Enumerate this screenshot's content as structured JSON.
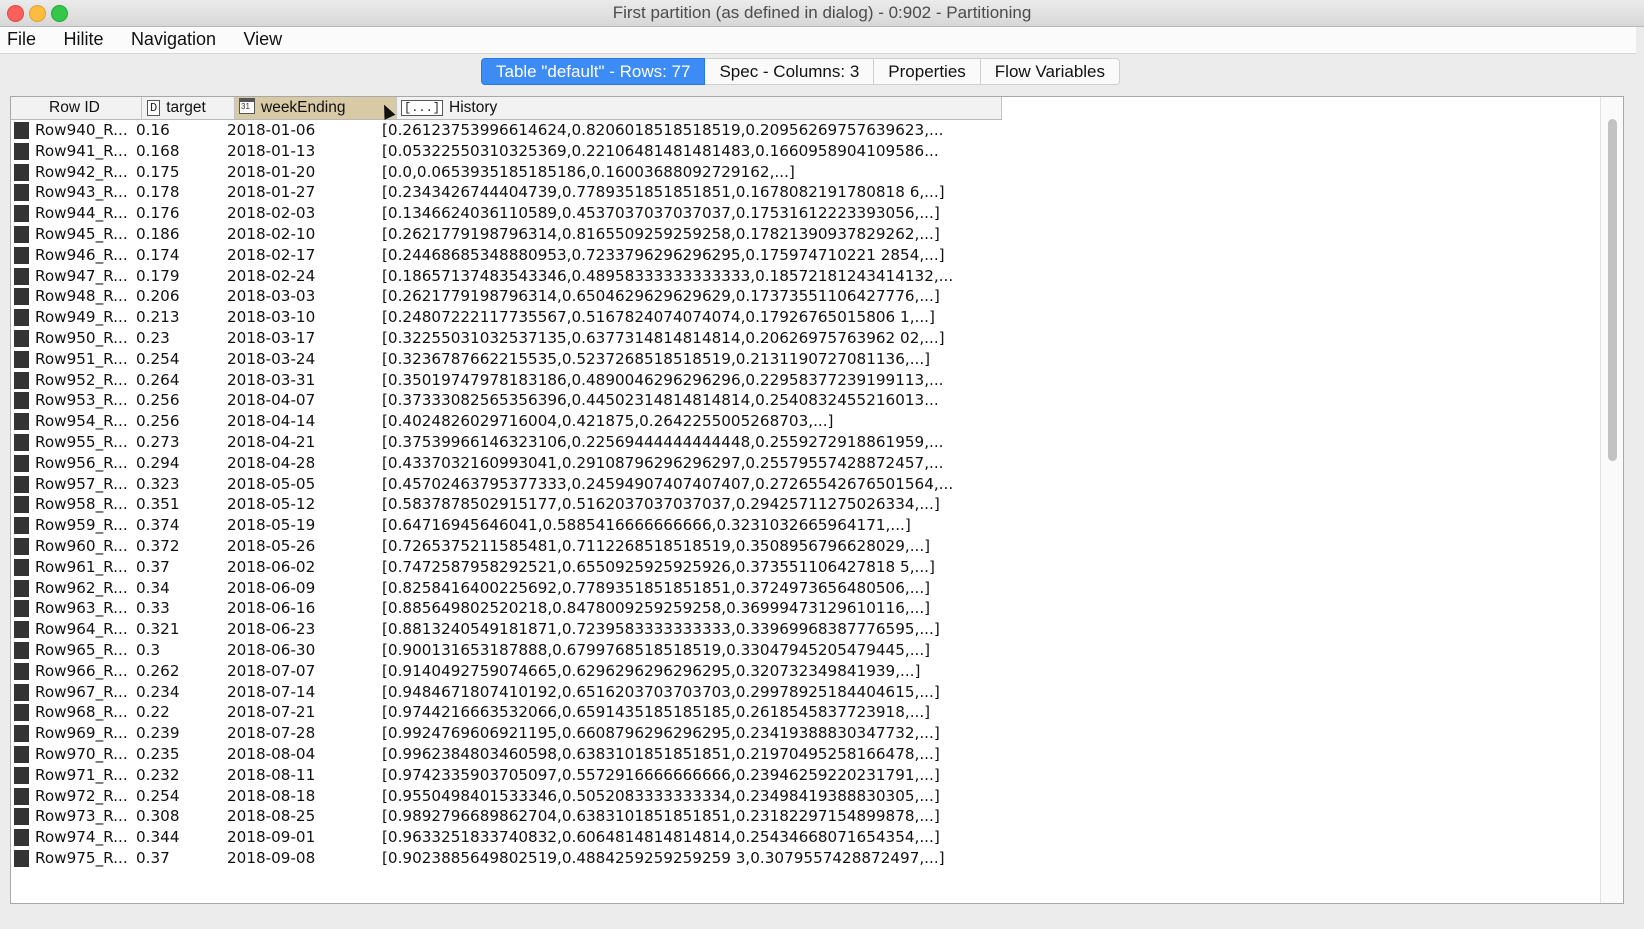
{
  "window": {
    "title": "First partition (as defined in dialog) - 0:902 - Partitioning"
  },
  "menu": [
    "File",
    "Hilite",
    "Navigation",
    "View"
  ],
  "tabs": [
    {
      "label": "Table \"default\" - Rows: 77",
      "active": true
    },
    {
      "label": "Spec - Columns: 3",
      "active": false
    },
    {
      "label": "Properties",
      "active": false
    },
    {
      "label": "Flow Variables",
      "active": false
    }
  ],
  "table": {
    "columns": [
      {
        "label": "Row ID",
        "type_icon": ""
      },
      {
        "label": "target",
        "type_icon": "D"
      },
      {
        "label": "weekEnding",
        "type_icon": "calendar-icon"
      },
      {
        "label": "History",
        "type_icon": "[...]"
      }
    ],
    "rows": [
      [
        "Row940_R...",
        "0.16",
        "2018-01-06",
        "[0.26123753996614624,0.8206018518518519,0.20956269757639623,..."
      ],
      [
        "Row941_R...",
        "0.168",
        "2018-01-13",
        "[0.05322550310325369,0.22106481481481483,0.1660958904109586..."
      ],
      [
        "Row942_R...",
        "0.175",
        "2018-01-20",
        "[0.0,0.0653935185185186,0.16003688092729162,...]"
      ],
      [
        "Row943_R...",
        "0.178",
        "2018-01-27",
        "[0.2343426744404739,0.7789351851851851,0.1678082191780818 6,...]"
      ],
      [
        "Row944_R...",
        "0.176",
        "2018-02-03",
        "[0.1346624036110589,0.4537037037037037,0.17531612223393056,...]"
      ],
      [
        "Row945_R...",
        "0.186",
        "2018-02-10",
        "[0.2621779198796314,0.8165509259259258,0.17821390937829262,...]"
      ],
      [
        "Row946_R...",
        "0.174",
        "2018-02-17",
        "[0.24468685348880953,0.7233796296296295,0.175974710221 2854,...]"
      ],
      [
        "Row947_R...",
        "0.179",
        "2018-02-24",
        "[0.18657137483543346,0.48958333333333333,0.18572181243414132,..."
      ],
      [
        "Row948_R...",
        "0.206",
        "2018-03-03",
        "[0.2621779198796314,0.6504629629629629,0.17373551106427776,...]"
      ],
      [
        "Row949_R...",
        "0.213",
        "2018-03-10",
        "[0.24807222117735567,0.5167824074074074,0.17926765015806 1,...]"
      ],
      [
        "Row950_R...",
        "0.23",
        "2018-03-17",
        "[0.32255031032537135,0.6377314814814814,0.20626975763962 02,...]"
      ],
      [
        "Row951_R...",
        "0.254",
        "2018-03-24",
        "[0.3236787662215535,0.5237268518518519,0.2131190727081136,...]"
      ],
      [
        "Row952_R...",
        "0.264",
        "2018-03-31",
        "[0.35019747978183186,0.4890046296296296,0.22958377239199113,..."
      ],
      [
        "Row953_R...",
        "0.256",
        "2018-04-07",
        "[0.37333082565356396,0.44502314814814814,0.2540832455216013..."
      ],
      [
        "Row954_R...",
        "0.256",
        "2018-04-14",
        "[0.4024826029716004,0.421875,0.2642255005268703,...]"
      ],
      [
        "Row955_R...",
        "0.273",
        "2018-04-21",
        "[0.37539966146323106,0.22569444444444448,0.2559272918861959,..."
      ],
      [
        "Row956_R...",
        "0.294",
        "2018-04-28",
        "[0.4337032160993041,0.29108796296296297,0.25579557428872457,..."
      ],
      [
        "Row957_R...",
        "0.323",
        "2018-05-05",
        "[0.45702463795377333,0.24594907407407407,0.27265542676501564,..."
      ],
      [
        "Row958_R...",
        "0.351",
        "2018-05-12",
        "[0.5837878502915177,0.5162037037037037,0.29425711275026334,...]"
      ],
      [
        "Row959_R...",
        "0.374",
        "2018-05-19",
        "[0.64716945646041,0.5885416666666666,0.3231032665964171,...]"
      ],
      [
        "Row960_R...",
        "0.372",
        "2018-05-26",
        "[0.7265375211585481,0.7112268518518519,0.3508956796628029,...]"
      ],
      [
        "Row961_R...",
        "0.37",
        "2018-06-02",
        "[0.7472587958292521,0.6550925925925926,0.373551106427818 5,...]"
      ],
      [
        "Row962_R...",
        "0.34",
        "2018-06-09",
        "[0.8258416400225692,0.7789351851851851,0.3724973656480506,...]"
      ],
      [
        "Row963_R...",
        "0.33",
        "2018-06-16",
        "[0.885649802520218,0.8478009259259258,0.36999473129610116,...]"
      ],
      [
        "Row964_R...",
        "0.321",
        "2018-06-23",
        "[0.8813240549181871,0.7239583333333333,0.33969968387776595,...]"
      ],
      [
        "Row965_R...",
        "0.3",
        "2018-06-30",
        "[0.900131653187888,0.6799768518518519,0.33047945205479445,...]"
      ],
      [
        "Row966_R...",
        "0.262",
        "2018-07-07",
        "[0.9140492759074665,0.6296296296296295,0.320732349841939,...]"
      ],
      [
        "Row967_R...",
        "0.234",
        "2018-07-14",
        "[0.9484671807410192,0.6516203703703703,0.29978925184404615,...]"
      ],
      [
        "Row968_R...",
        "0.22",
        "2018-07-21",
        "[0.9744216663532066,0.6591435185185185,0.2618545837723918,...]"
      ],
      [
        "Row969_R...",
        "0.239",
        "2018-07-28",
        "[0.9924769606921195,0.6608796296296295,0.23419388830347732,...]"
      ],
      [
        "Row970_R...",
        "0.235",
        "2018-08-04",
        "[0.9962384803460598,0.6383101851851851,0.21970495258166478,...]"
      ],
      [
        "Row971_R...",
        "0.232",
        "2018-08-11",
        "[0.9742335903705097,0.5572916666666666,0.23946259220231791,...]"
      ],
      [
        "Row972_R...",
        "0.254",
        "2018-08-18",
        "[0.9550498401533346,0.5052083333333334,0.23498419388830305,...]"
      ],
      [
        "Row973_R...",
        "0.308",
        "2018-08-25",
        "[0.9892796689862704,0.6383101851851851,0.23182297154899878,...]"
      ],
      [
        "Row974_R...",
        "0.344",
        "2018-09-01",
        "[0.9633251833740832,0.6064814814814814,0.25434668071654354,...]"
      ],
      [
        "Row975_R...",
        "0.37",
        "2018-09-08",
        "[0.9023885649802519,0.4884259259259259 3,0.3079557428872497,...]"
      ]
    ]
  },
  "colors": {
    "active_tab": "#3d8cf5",
    "sorted_header": "#d8caa5",
    "row_marker": "#333333"
  }
}
